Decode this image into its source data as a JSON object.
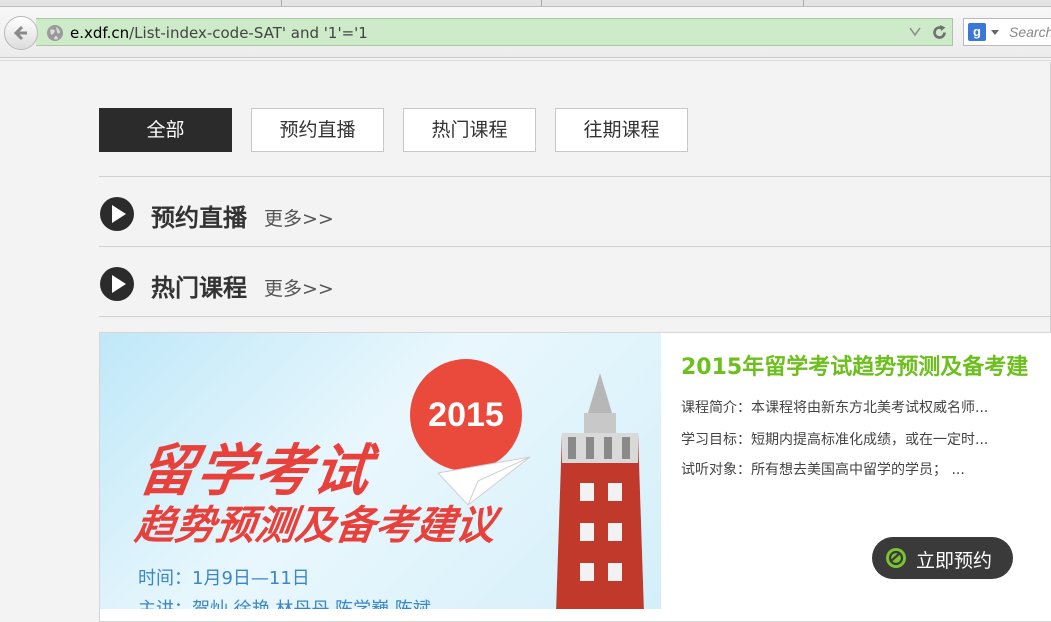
{
  "browser": {
    "url_host": "e.xdf.cn",
    "url_path": "/List-index-code-SAT' and '1'='1",
    "search_placeholder": "Search",
    "search_engine_letter": "g"
  },
  "filters": {
    "tabs": [
      {
        "label": "全部",
        "active": true
      },
      {
        "label": "预约直播",
        "active": false
      },
      {
        "label": "热门课程",
        "active": false
      },
      {
        "label": "往期课程",
        "active": false
      }
    ]
  },
  "sections": [
    {
      "title": "预约直播",
      "more": "更多>>"
    },
    {
      "title": "热门课程",
      "more": "更多>>"
    }
  ],
  "course": {
    "banner": {
      "title_line1": "留学考试",
      "title_line2": "趋势预测及备考建议",
      "year": "2015",
      "time": "时间：1月9日—11日",
      "hosts": "主讲：贺灿    徐艳    林丹丹    陈学巍    陈斌"
    },
    "title": "2015年留学考试趋势预测及备考建",
    "intro": "课程简介：本课程将由新东方北美考试权威名师...",
    "goal": "学习目标：短期内提高标准化成绩，或在一定时...",
    "audience": "试听对象：所有想去美国高中留学的学员；  ...",
    "reserve_label": "立即预约"
  },
  "colors": {
    "accent_green": "#6cbf1d",
    "banner_red": "#e8403b",
    "active_tab_bg": "#2b2b2b",
    "urlbar_bg": "#cdeac9"
  }
}
